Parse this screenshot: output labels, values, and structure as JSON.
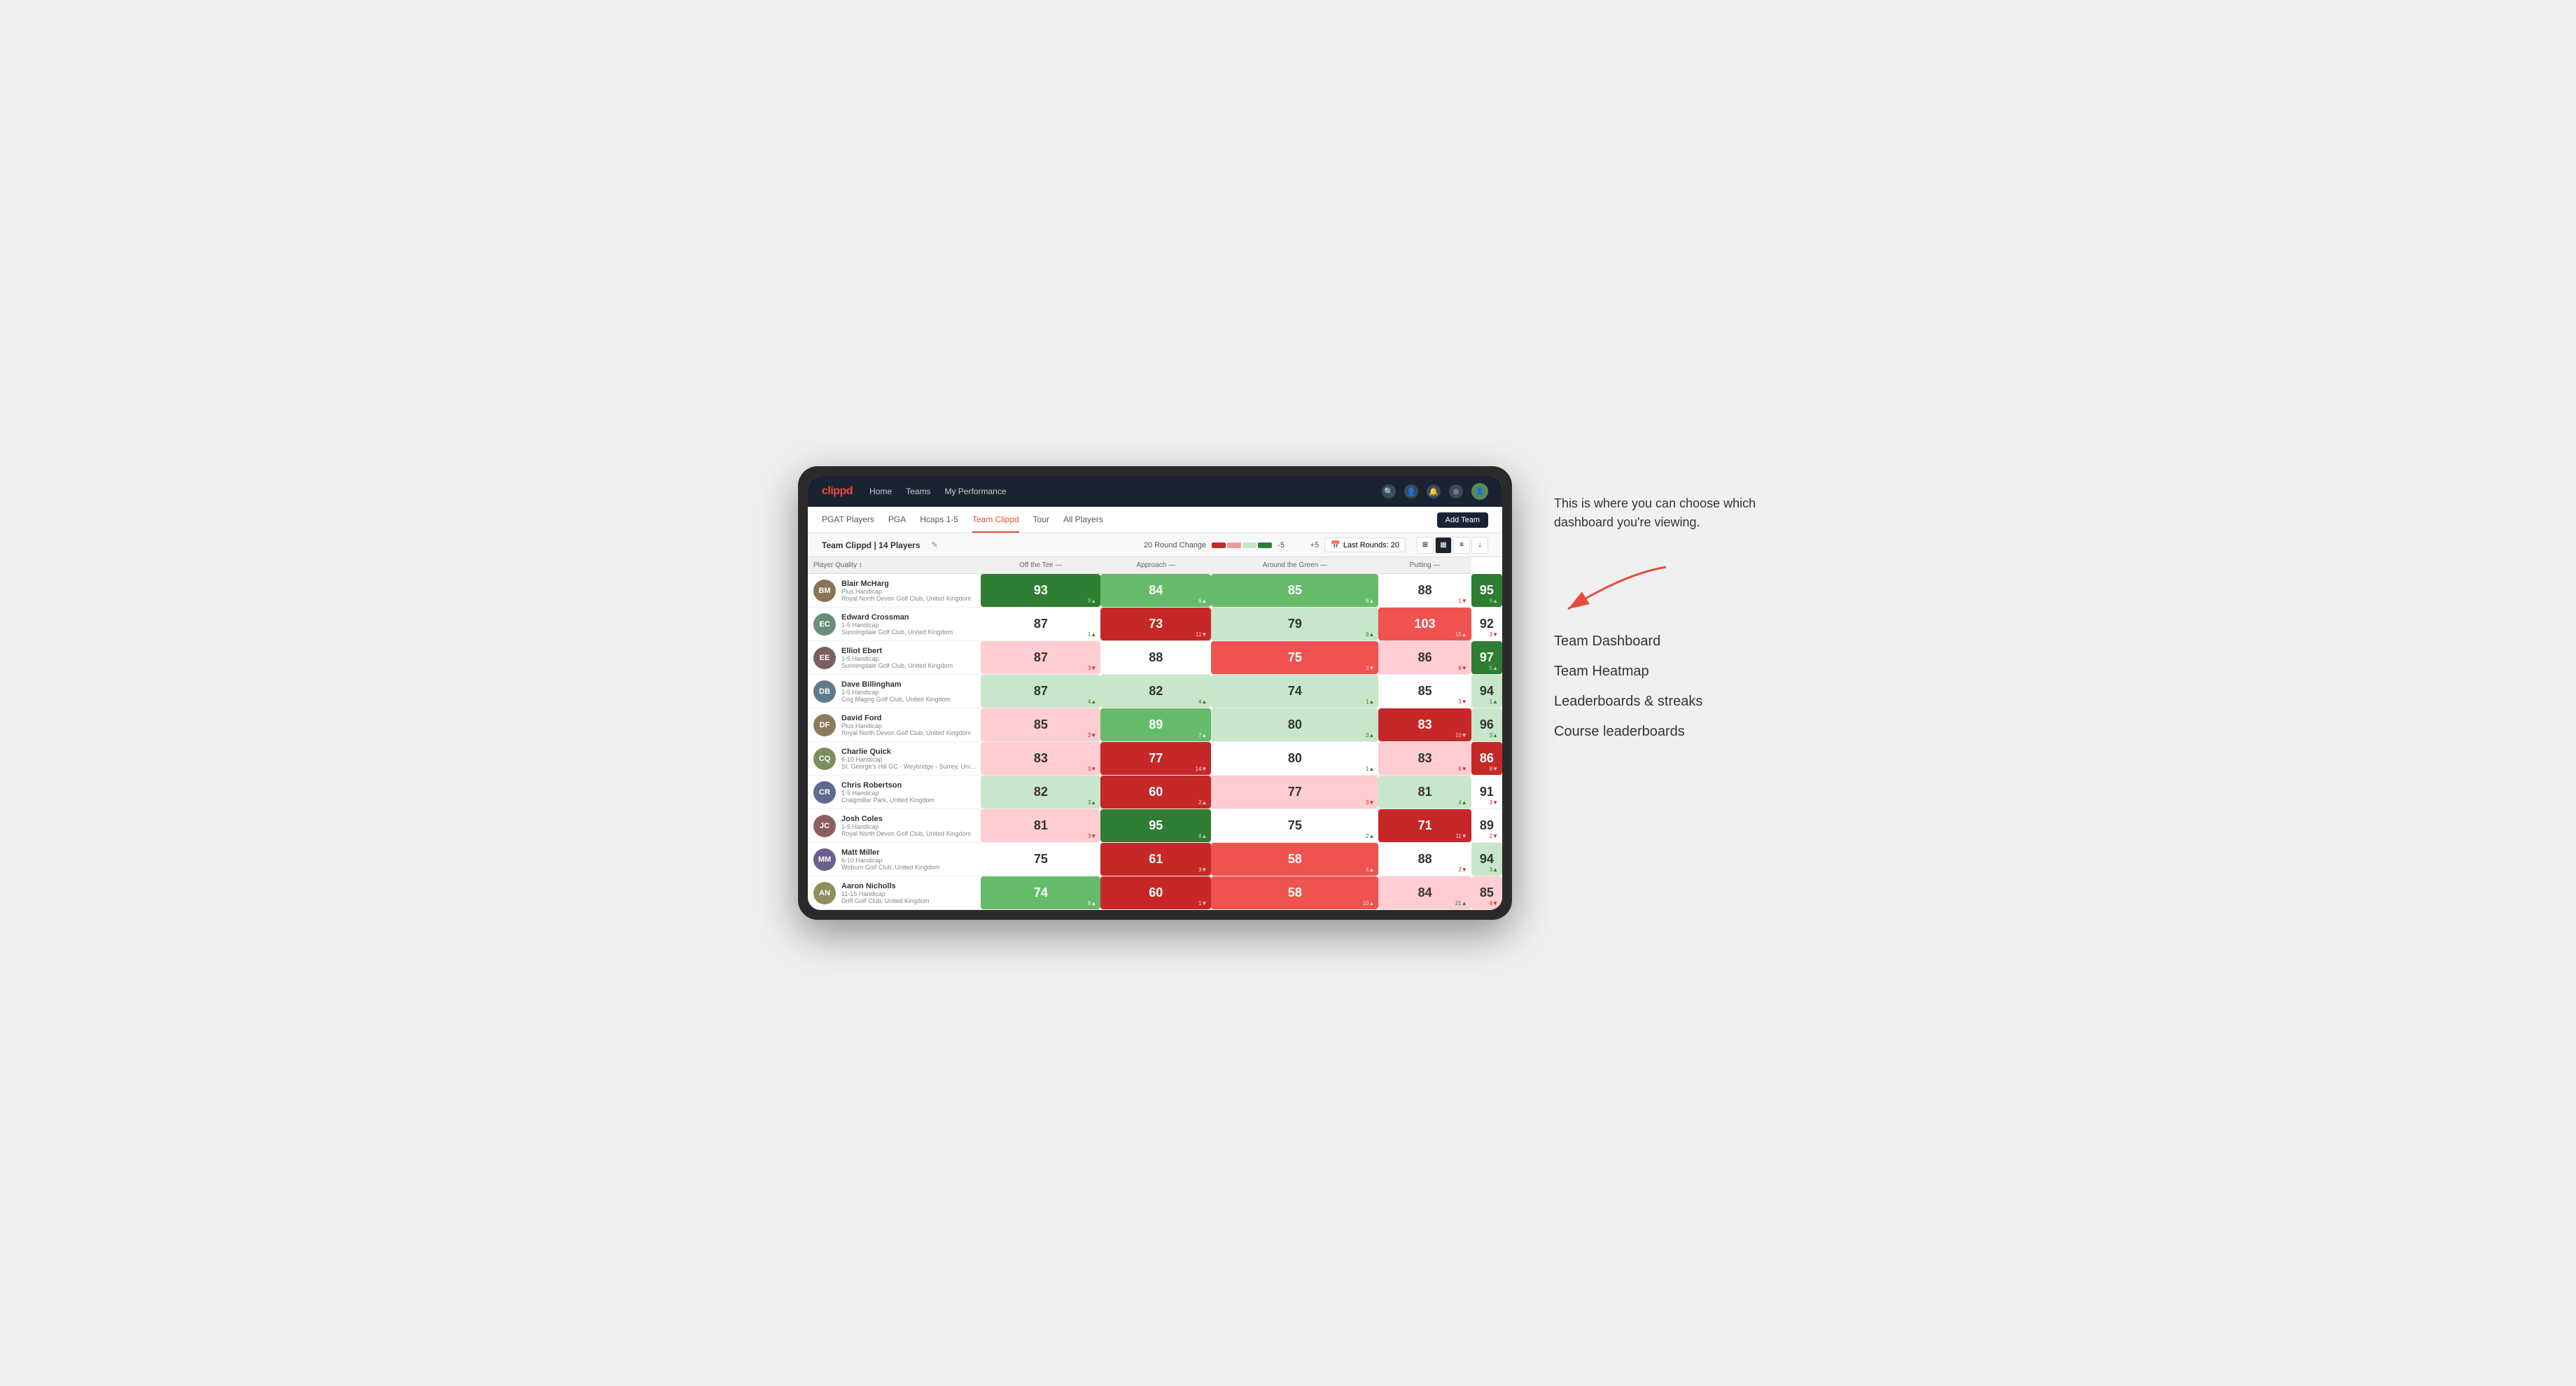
{
  "brand": "clippd",
  "navbar": {
    "links": [
      "Home",
      "Teams",
      "My Performance"
    ],
    "icons": [
      "🔍",
      "👤",
      "🔔",
      "⊕",
      "👤"
    ]
  },
  "secondary_nav": {
    "tabs": [
      "PGAT Players",
      "PGA",
      "Hcaps 1-5",
      "Team Clippd",
      "Tour",
      "All Players"
    ],
    "active": "Team Clippd",
    "add_button": "Add Team"
  },
  "team_header": {
    "title": "Team Clippd | 14 Players",
    "round_change_label": "20 Round Change",
    "range_min": "-5",
    "range_max": "+5",
    "last_rounds_label": "Last Rounds: 20"
  },
  "table": {
    "columns": {
      "player": "Player Quality ↕",
      "off_tee": "Off the Tee —",
      "approach": "Approach —",
      "around_green": "Around the Green —",
      "putting": "Putting —"
    },
    "rows": [
      {
        "name": "Blair McHarg",
        "handicap": "Plus Handicap",
        "club": "Royal North Devon Golf Club, United Kingdom",
        "initials": "BM",
        "color": "#8B7355",
        "off_tee": {
          "value": 93,
          "change": "9▲",
          "dir": "up",
          "bg": "bg-green-strong"
        },
        "approach": {
          "value": 84,
          "change": "6▲",
          "dir": "up",
          "bg": "bg-green-mid"
        },
        "around_green": {
          "value": 85,
          "change": "8▲",
          "dir": "up",
          "bg": "bg-green-mid"
        },
        "putting_atg": {
          "value": 88,
          "change": "1▼",
          "dir": "down",
          "bg": "bg-white"
        },
        "putting": {
          "value": 95,
          "change": "9▲",
          "dir": "up",
          "bg": "bg-green-strong"
        }
      },
      {
        "name": "Edward Crossman",
        "handicap": "1-5 Handicap",
        "club": "Sunningdale Golf Club, United Kingdom",
        "initials": "EC",
        "color": "#6B8E7B",
        "off_tee": {
          "value": 87,
          "change": "1▲",
          "dir": "up",
          "bg": "bg-white"
        },
        "approach": {
          "value": 73,
          "change": "11▼",
          "dir": "down",
          "bg": "bg-red-strong"
        },
        "around_green": {
          "value": 79,
          "change": "9▲",
          "dir": "up",
          "bg": "bg-green-light"
        },
        "putting_atg": {
          "value": 103,
          "change": "15▲",
          "dir": "up",
          "bg": "bg-red-mid"
        },
        "putting": {
          "value": 92,
          "change": "3▼",
          "dir": "down",
          "bg": "bg-white"
        }
      },
      {
        "name": "Elliot Ebert",
        "handicap": "1-5 Handicap",
        "club": "Sunningdale Golf Club, United Kingdom",
        "initials": "EE",
        "color": "#7B5E5E",
        "off_tee": {
          "value": 87,
          "change": "3▼",
          "dir": "down",
          "bg": "bg-red-light"
        },
        "approach": {
          "value": 88,
          "change": "",
          "dir": "none",
          "bg": "bg-white"
        },
        "around_green": {
          "value": 75,
          "change": "3▼",
          "dir": "down",
          "bg": "bg-red-mid"
        },
        "putting_atg": {
          "value": 86,
          "change": "6▼",
          "dir": "down",
          "bg": "bg-red-light"
        },
        "putting": {
          "value": 97,
          "change": "5▲",
          "dir": "up",
          "bg": "bg-green-strong"
        }
      },
      {
        "name": "Dave Billingham",
        "handicap": "1-5 Handicap",
        "club": "Gog Magog Golf Club, United Kingdom",
        "initials": "DB",
        "color": "#5E7B8E",
        "off_tee": {
          "value": 87,
          "change": "4▲",
          "dir": "up",
          "bg": "bg-green-light"
        },
        "approach": {
          "value": 82,
          "change": "4▲",
          "dir": "up",
          "bg": "bg-green-light"
        },
        "around_green": {
          "value": 74,
          "change": "1▲",
          "dir": "up",
          "bg": "bg-green-light"
        },
        "putting_atg": {
          "value": 85,
          "change": "3▼",
          "dir": "down",
          "bg": "bg-white"
        },
        "putting": {
          "value": 94,
          "change": "1▲",
          "dir": "up",
          "bg": "bg-green-light"
        }
      },
      {
        "name": "David Ford",
        "handicap": "Plus Handicap",
        "club": "Royal North Devon Golf Club, United Kingdom",
        "initials": "DF",
        "color": "#8E7B5E",
        "off_tee": {
          "value": 85,
          "change": "3▼",
          "dir": "down",
          "bg": "bg-red-light"
        },
        "approach": {
          "value": 89,
          "change": "7▲",
          "dir": "up",
          "bg": "bg-green-mid"
        },
        "around_green": {
          "value": 80,
          "change": "3▲",
          "dir": "up",
          "bg": "bg-green-light"
        },
        "putting_atg": {
          "value": 83,
          "change": "10▼",
          "dir": "down",
          "bg": "bg-red-strong"
        },
        "putting": {
          "value": 96,
          "change": "3▲",
          "dir": "up",
          "bg": "bg-green-light"
        }
      },
      {
        "name": "Charlie Quick",
        "handicap": "6-10 Handicap",
        "club": "St. George's Hill GC - Weybridge - Surrey, Uni...",
        "initials": "CQ",
        "color": "#7B8E5E",
        "off_tee": {
          "value": 83,
          "change": "3▼",
          "dir": "down",
          "bg": "bg-red-light"
        },
        "approach": {
          "value": 77,
          "change": "14▼",
          "dir": "down",
          "bg": "bg-red-strong"
        },
        "around_green": {
          "value": 80,
          "change": "1▲",
          "dir": "up",
          "bg": "bg-white"
        },
        "putting_atg": {
          "value": 83,
          "change": "6▼",
          "dir": "down",
          "bg": "bg-red-light"
        },
        "putting": {
          "value": 86,
          "change": "8▼",
          "dir": "down",
          "bg": "bg-red-strong"
        }
      },
      {
        "name": "Chris Robertson",
        "handicap": "1-5 Handicap",
        "club": "Craigmillar Park, United Kingdom",
        "initials": "CR",
        "color": "#5E6B8E",
        "off_tee": {
          "value": 82,
          "change": "3▲",
          "dir": "up",
          "bg": "bg-green-light"
        },
        "approach": {
          "value": 60,
          "change": "2▲",
          "dir": "up",
          "bg": "bg-red-strong"
        },
        "around_green": {
          "value": 77,
          "change": "3▼",
          "dir": "down",
          "bg": "bg-red-light"
        },
        "putting_atg": {
          "value": 81,
          "change": "4▲",
          "dir": "up",
          "bg": "bg-green-light"
        },
        "putting": {
          "value": 91,
          "change": "3▼",
          "dir": "down",
          "bg": "bg-white"
        }
      },
      {
        "name": "Josh Coles",
        "handicap": "1-5 Handicap",
        "club": "Royal North Devon Golf Club, United Kingdom",
        "initials": "JC",
        "color": "#8E5E5E",
        "off_tee": {
          "value": 81,
          "change": "3▼",
          "dir": "down",
          "bg": "bg-red-light"
        },
        "approach": {
          "value": 95,
          "change": "8▲",
          "dir": "up",
          "bg": "bg-green-strong"
        },
        "around_green": {
          "value": 75,
          "change": "2▲",
          "dir": "up",
          "bg": "bg-white"
        },
        "putting_atg": {
          "value": 71,
          "change": "11▼",
          "dir": "down",
          "bg": "bg-red-strong"
        },
        "putting": {
          "value": 89,
          "change": "2▼",
          "dir": "down",
          "bg": "bg-white"
        }
      },
      {
        "name": "Matt Miller",
        "handicap": "6-10 Handicap",
        "club": "Woburn Golf Club, United Kingdom",
        "initials": "MM",
        "color": "#6B5E8E",
        "off_tee": {
          "value": 75,
          "change": "",
          "dir": "none",
          "bg": "bg-white"
        },
        "approach": {
          "value": 61,
          "change": "3▼",
          "dir": "down",
          "bg": "bg-red-strong"
        },
        "around_green": {
          "value": 58,
          "change": "4▲",
          "dir": "up",
          "bg": "bg-red-mid"
        },
        "putting_atg": {
          "value": 88,
          "change": "2▼",
          "dir": "down",
          "bg": "bg-white"
        },
        "putting": {
          "value": 94,
          "change": "3▲",
          "dir": "up",
          "bg": "bg-green-light"
        }
      },
      {
        "name": "Aaron Nicholls",
        "handicap": "11-15 Handicap",
        "club": "Drift Golf Club, United Kingdom",
        "initials": "AN",
        "color": "#8E8E5E",
        "off_tee": {
          "value": 74,
          "change": "8▲",
          "dir": "up",
          "bg": "bg-green-mid"
        },
        "approach": {
          "value": 60,
          "change": "1▼",
          "dir": "down",
          "bg": "bg-red-strong"
        },
        "around_green": {
          "value": 58,
          "change": "10▲",
          "dir": "up",
          "bg": "bg-red-mid"
        },
        "putting_atg": {
          "value": 84,
          "change": "21▲",
          "dir": "up",
          "bg": "bg-red-light"
        },
        "putting": {
          "value": 85,
          "change": "4▼",
          "dir": "down",
          "bg": "bg-red-light"
        }
      }
    ]
  },
  "annotation": {
    "intro": "This is where you can choose which dashboard you're viewing.",
    "options": [
      "Team Dashboard",
      "Team Heatmap",
      "Leaderboards & streaks",
      "Course leaderboards"
    ]
  }
}
